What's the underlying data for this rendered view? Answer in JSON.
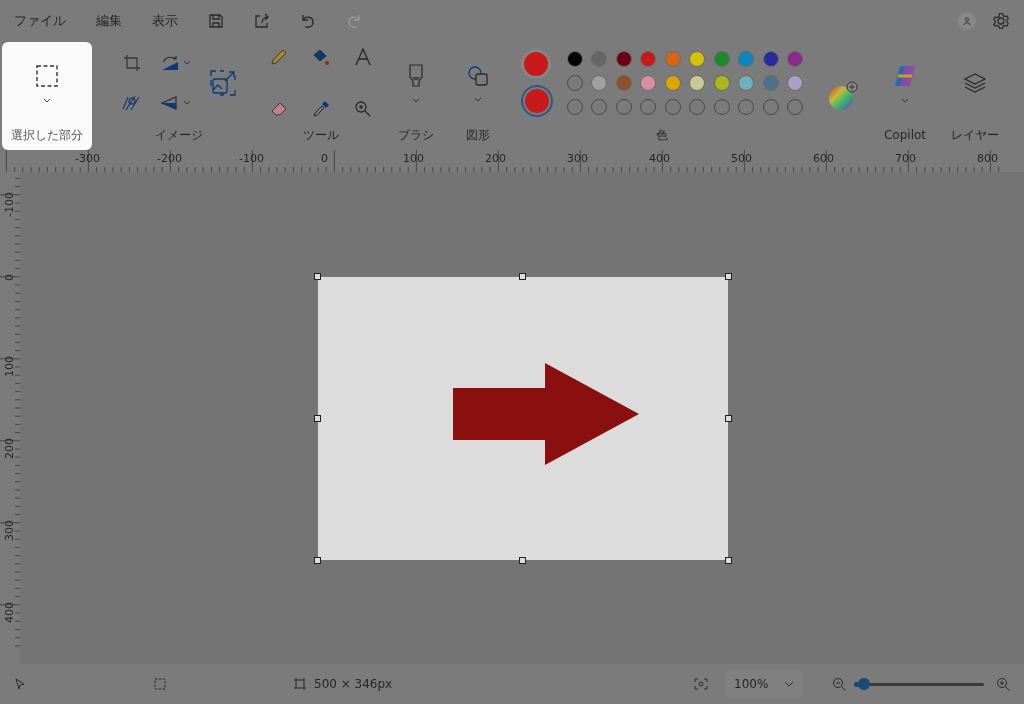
{
  "menu": [
    {
      "label": "ファイル"
    },
    {
      "label": "編集"
    },
    {
      "label": "表示"
    }
  ],
  "ribbon_groups": [
    {
      "label": "選択した部分",
      "selected": true
    },
    {
      "label": "イメージ",
      "selected": false
    },
    {
      "label": "ツール",
      "selected": false
    },
    {
      "label": "ブラシ",
      "selected": false
    },
    {
      "label": "図形",
      "selected": false
    },
    {
      "label": "色",
      "selected": false
    },
    {
      "label": "Copilot",
      "selected": false
    },
    {
      "label": "レイヤー",
      "selected": false
    }
  ],
  "current_colors": [
    {
      "color": "#c81a1a",
      "selected": false
    },
    {
      "color": "#c81a1a",
      "selected": true
    }
  ],
  "palette": [
    {
      "kind": "swatch",
      "color": "#000000"
    },
    {
      "kind": "swatch",
      "color": "#666666"
    },
    {
      "kind": "swatch",
      "color": "#6a0014"
    },
    {
      "kind": "swatch",
      "color": "#c81a1a"
    },
    {
      "kind": "swatch",
      "color": "#d8641a"
    },
    {
      "kind": "swatch",
      "color": "#d4c400"
    },
    {
      "kind": "swatch",
      "color": "#1a8a2a"
    },
    {
      "kind": "swatch",
      "color": "#0a86c0"
    },
    {
      "kind": "swatch",
      "color": "#2a2aa0"
    },
    {
      "kind": "swatch",
      "color": "#8a2a8a"
    },
    {
      "kind": "empty"
    },
    {
      "kind": "swatch",
      "color": "#a0a0a0"
    },
    {
      "kind": "swatch",
      "color": "#8a5030"
    },
    {
      "kind": "swatch",
      "color": "#d890a0"
    },
    {
      "kind": "swatch",
      "color": "#d8a800"
    },
    {
      "kind": "swatch",
      "color": "#c8c898"
    },
    {
      "kind": "swatch",
      "color": "#a8b818"
    },
    {
      "kind": "swatch",
      "color": "#70b0b8"
    },
    {
      "kind": "swatch",
      "color": "#507090"
    },
    {
      "kind": "swatch",
      "color": "#a8a0c8"
    },
    {
      "kind": "empty"
    },
    {
      "kind": "empty"
    },
    {
      "kind": "empty"
    },
    {
      "kind": "empty"
    },
    {
      "kind": "empty"
    },
    {
      "kind": "empty"
    },
    {
      "kind": "empty"
    },
    {
      "kind": "empty"
    },
    {
      "kind": "empty"
    },
    {
      "kind": "empty"
    }
  ],
  "ruler_horizontal": [
    "-300",
    "-200",
    "-100",
    "0",
    "100",
    "200",
    "300",
    "400",
    "500",
    "600",
    "700",
    "800"
  ],
  "ruler_vertical": [
    "-100",
    "0",
    "100",
    "200",
    "300",
    "400"
  ],
  "status_bar": {
    "canvas_size": "500 × 346px",
    "zoom": "100%",
    "zoom_slider": {
      "level": 0.08
    }
  }
}
